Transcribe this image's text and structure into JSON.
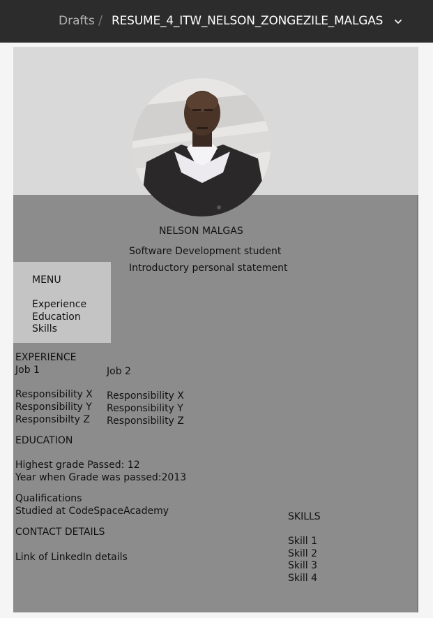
{
  "topbar": {
    "breadcrumb_parent": "Drafts",
    "separator": "/",
    "file_name": "RESUME_4_ITW_NELSON_ZONGEZILE_MALGAS"
  },
  "profile": {
    "name": "NELSON MALGAS",
    "title": "Software Development student",
    "statement": "Introductory personal statement"
  },
  "menu": {
    "heading": "MENU",
    "items": [
      "Experience",
      "Education",
      "Skills"
    ]
  },
  "experience": {
    "heading": "EXPERIENCE",
    "jobs": [
      {
        "title": "Job 1",
        "responsibilities": [
          "Responsibility X",
          "Responsibility Y",
          "Responsibilty Z"
        ]
      },
      {
        "title": "Job 2",
        "responsibilities": [
          "Responsibility X",
          "Responsibility Y",
          "Responsibility Z"
        ]
      }
    ]
  },
  "education": {
    "heading": "EDUCATION",
    "grade": "Highest grade Passed: 12",
    "year": "Year when Grade was passed:2013",
    "qualifications_heading": "Qualifications",
    "studied": "Studied at CodeSpaceAcademy"
  },
  "contact": {
    "heading": "CONTACT DETAILS",
    "linkedin": "Link of LinkedIn details"
  },
  "skills": {
    "heading": "SKILLS",
    "items": [
      "Skill 1",
      "Skill 2",
      "Skill 3",
      "Skill 4"
    ]
  },
  "colors": {
    "topbar": "#2c2c2c",
    "header_band": "#d9d9d9",
    "body": "#8c8c8c",
    "menu": "#c4c4c4"
  },
  "icons": {
    "chevron": "chevron-down-icon",
    "photo": "profile-photo"
  }
}
